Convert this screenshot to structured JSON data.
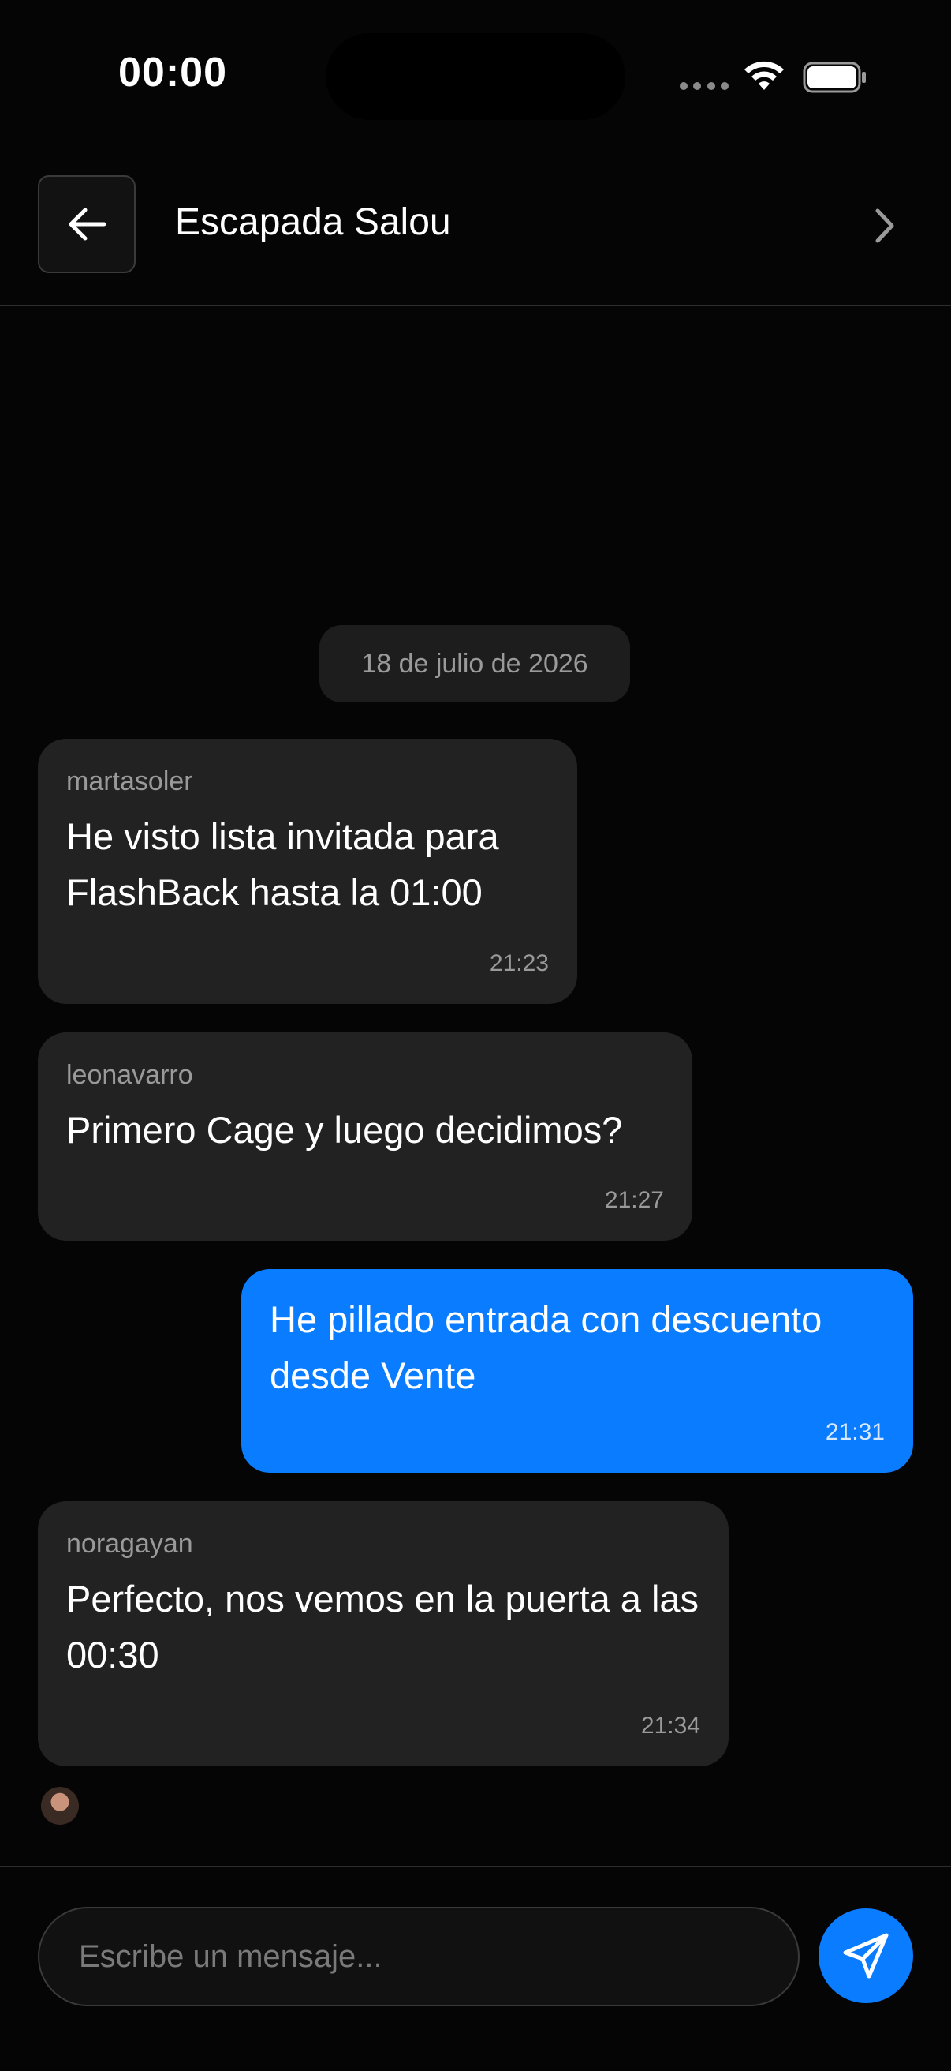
{
  "status_bar": {
    "time": "00:00"
  },
  "header": {
    "title": "Escapada Salou",
    "back_icon": "arrow-left-icon",
    "chevron_icon": "chevron-right-icon"
  },
  "chat": {
    "date_label": "18 de julio de 2026",
    "messages": [
      {
        "sender": "martasoler",
        "text": "He visto lista invitada para FlashBack hasta la 01:00",
        "time": "21:23",
        "outgoing": false
      },
      {
        "sender": "leonavarro",
        "text": "Primero Cage y luego decidimos?",
        "time": "21:27",
        "outgoing": false
      },
      {
        "sender": "",
        "text": "He pillado entrada con descuento desde Vente",
        "time": "21:31",
        "outgoing": true
      },
      {
        "sender": "noragayan",
        "text": "Perfecto, nos vemos en la puerta a las 00:30",
        "time": "21:34",
        "outgoing": false
      }
    ]
  },
  "composer": {
    "placeholder": "Escribe un mensaje...",
    "value": "",
    "send_icon": "send-icon"
  },
  "colors": {
    "background": "#050505",
    "incoming_bubble": "#222222",
    "outgoing_bubble": "#0a7cff",
    "accent": "#0a7cff",
    "secondary_text": "#9a9a9a"
  }
}
